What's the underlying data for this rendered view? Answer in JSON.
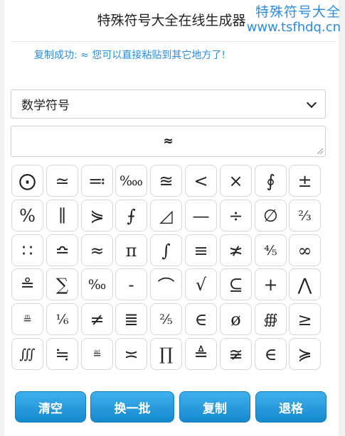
{
  "header": {
    "title": "特殊符号大全在线生成器",
    "watermark_title": "特殊符号大全",
    "watermark_url": "www.tsfhdq.cn"
  },
  "status_message": "复制成功: ≈ 您可以直接粘贴到其它地方了!",
  "category_select": {
    "selected": "数学符号"
  },
  "output": {
    "value": "≈"
  },
  "symbols": [
    "⨀",
    "≃",
    "≕",
    "‱",
    "≊",
    "<",
    "×",
    "∮",
    "±",
    "%",
    "∥",
    "⋟",
    "⨍",
    "◿",
    "—",
    "÷",
    "∅",
    "⅔",
    "∷",
    "≏",
    "≈",
    "π",
    "∫",
    "≡",
    "≭",
    "⅘",
    "∞",
    "≗",
    "∑",
    "‰",
    "-",
    "⌒",
    "√",
    "⊆",
    "+",
    "⋀",
    "≞",
    "⅙",
    "≠",
    "≣",
    "⅖",
    "∈",
    "ø",
    "∰",
    "≥",
    "∭",
    "≒",
    "≝",
    "≍",
    "∏",
    "≜",
    "≆",
    "∈",
    "≽"
  ],
  "buttons": {
    "clear": "清空",
    "next_batch": "换一批",
    "copy": "复制",
    "backspace": "退格"
  },
  "colors": {
    "accent": "#2a8ce0",
    "button_top": "#3fb0ec",
    "button_bottom": "#1689cf"
  }
}
